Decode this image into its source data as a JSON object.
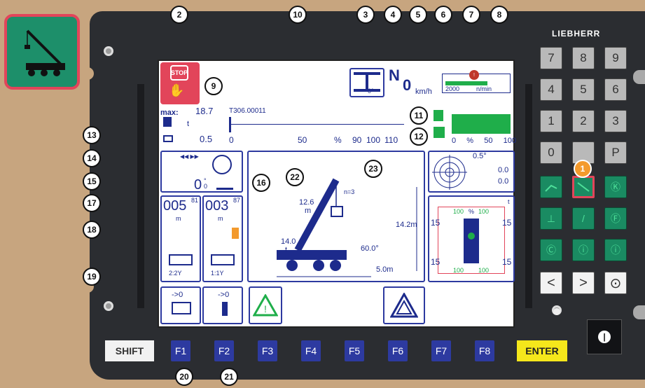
{
  "brand": "LIEBHERR",
  "numpad": [
    "7",
    "8",
    "9",
    "4",
    "5",
    "6",
    "1",
    "2",
    "3",
    "0",
    "",
    "P"
  ],
  "function_keys": [
    "F1",
    "F2",
    "F3",
    "F4",
    "F5",
    "F6",
    "F7",
    "F8"
  ],
  "shift_label": "SHIFT",
  "enter_label": "ENTER",
  "callouts": [
    "1",
    "2",
    "3",
    "4",
    "5",
    "6",
    "7",
    "8",
    "9",
    "10",
    "11",
    "12",
    "13",
    "14",
    "15",
    "16",
    "17",
    "18",
    "19",
    "20",
    "21",
    "22",
    "23"
  ],
  "screen": {
    "stop_label": "STOP",
    "gear": "N",
    "speed_value": "0",
    "speed_unit": "km/h",
    "rpm_value": "2000",
    "rpm_unit": "n/min",
    "max_label": "max:",
    "max_value": "18.7",
    "load_code": "T306.00011",
    "t_unit": "t",
    "min_value": "0.5",
    "scale_0": "0",
    "scale_50": "50",
    "scale_pct": "%",
    "scale_90": "90",
    "scale_100": "100",
    "scale_110": "110",
    "fuel_scale": [
      "0",
      "%",
      "50",
      "100"
    ],
    "slew_deg": "0",
    "slew_sup": "0",
    "slew_unit": "°",
    "winch1": "005",
    "winch1_sup": "81",
    "winch1_unit": "m",
    "winch2": "003",
    "winch2_sup": "87",
    "winch2_unit": "m",
    "reeving1": "2:2Y",
    "reeving2": "1:1Y",
    "reset1": "->0",
    "reset2": "->0",
    "boom_length": "12.6",
    "boom_len_unit": "m",
    "n_label": "n=3",
    "load_at": "14.0",
    "load_t": "t",
    "angle": "60.0°",
    "radius": "5.0m",
    "height": "14.2m",
    "incl_angle": "0.5°",
    "incl_x": "0.0",
    "incl_y": "0.0",
    "outrigger_unit": "t",
    "outrigger_pct": [
      "100",
      "%",
      "100"
    ],
    "outrigger_vals": [
      "15",
      "15",
      "15",
      "15"
    ],
    "outrigger_bottom": [
      "100",
      "100"
    ],
    "slew_top": "0°"
  }
}
